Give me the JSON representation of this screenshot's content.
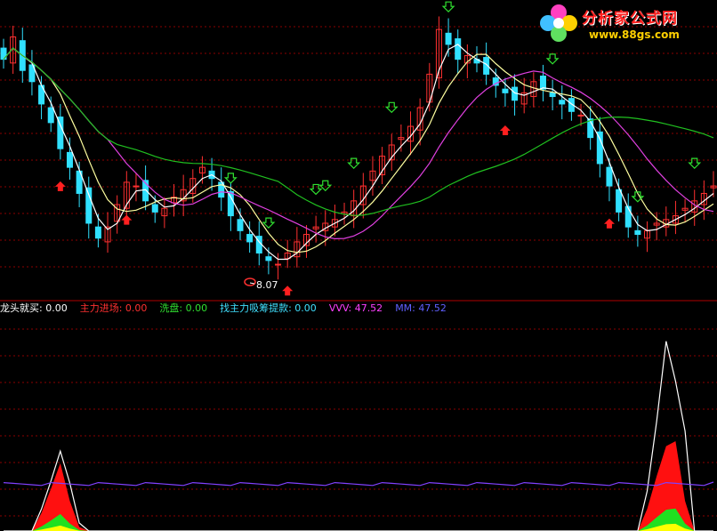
{
  "logo": {
    "brand": "分析家公式网",
    "url": "www.88gs.com"
  },
  "indicator_bar": [
    {
      "label": "龙头就买:",
      "value": "0.00",
      "color": "#ffffff"
    },
    {
      "label": "主力进场:",
      "value": "0.00",
      "color": "#ff3030"
    },
    {
      "label": "洗盘:",
      "value": "0.00",
      "color": "#30e030"
    },
    {
      "label": "找主力吸筹提款:",
      "value": "0.00",
      "color": "#40e0ff"
    },
    {
      "label": "VVV:",
      "value": "47.52",
      "color": "#ff40ff"
    },
    {
      "label": "MM:",
      "value": "47.52",
      "color": "#6060ff"
    }
  ],
  "price_low_marker": "8.07",
  "colors": {
    "up": "#ff3030",
    "down": "#30e0ff",
    "ma_short": "#ffffff",
    "ma_mid": "#ffffa0",
    "ma_long": "#e040e0",
    "ma_xlong": "#20c020",
    "grid": "#8b0000",
    "divider": "#a00000"
  },
  "chart_data": [
    {
      "type": "candlestick",
      "panel": "price",
      "closes": [
        13.8,
        14.4,
        13.5,
        13.2,
        12.6,
        12.1,
        11.4,
        10.9,
        10.2,
        9.4,
        9.0,
        9.3,
        9.9,
        10.5,
        10.4,
        10.0,
        9.7,
        9.8,
        10.1,
        10.3,
        10.6,
        10.9,
        10.6,
        10.1,
        9.6,
        9.2,
        8.9,
        8.6,
        8.4,
        8.3,
        8.6,
        8.9,
        9.1,
        9.3,
        9.4,
        9.5,
        9.7,
        10.0,
        10.4,
        10.8,
        11.2,
        11.5,
        11.7,
        12.0,
        12.5,
        13.4,
        14.6,
        14.2,
        13.8,
        13.9,
        13.7,
        13.4,
        13.1,
        12.9,
        12.7,
        12.9,
        13.2,
        13.0,
        12.8,
        12.6,
        12.4,
        12.3,
        11.7,
        11.0,
        10.4,
        9.7,
        9.3,
        9.1,
        9.2,
        9.4,
        9.5,
        9.6,
        9.8,
        10.0,
        10.2,
        10.4
      ],
      "marks": {
        "green_down_arrows": 10,
        "red_up_arrows": 5
      }
    },
    {
      "type": "area",
      "panel": "indicator",
      "series": [
        {
          "name": "主力进场",
          "values": [
            0,
            0,
            0,
            0,
            18,
            42,
            68,
            30,
            4,
            0,
            0,
            0,
            0,
            0,
            0,
            0,
            0,
            0,
            0,
            0,
            0,
            0,
            0,
            0,
            0,
            0,
            0,
            0,
            0,
            0,
            0,
            0,
            0,
            0,
            0,
            0,
            0,
            0,
            0,
            0,
            0,
            0,
            0,
            0,
            0,
            0,
            0,
            0,
            0,
            0,
            0,
            0,
            0,
            0,
            0,
            0,
            0,
            0,
            0,
            0,
            0,
            0,
            0,
            0,
            0,
            0,
            0,
            0,
            22,
            55,
            85,
            90,
            30,
            0,
            0,
            0
          ]
        },
        {
          "name": "龙头就买",
          "values": [
            0,
            0,
            0,
            0,
            22,
            50,
            80,
            48,
            8,
            0,
            0,
            0,
            0,
            0,
            0,
            0,
            0,
            0,
            0,
            0,
            0,
            0,
            0,
            0,
            0,
            0,
            0,
            0,
            0,
            0,
            0,
            0,
            0,
            0,
            0,
            0,
            0,
            0,
            0,
            0,
            0,
            0,
            0,
            0,
            0,
            0,
            0,
            0,
            0,
            0,
            0,
            0,
            0,
            0,
            0,
            0,
            0,
            0,
            0,
            0,
            0,
            0,
            0,
            0,
            0,
            0,
            0,
            0,
            40,
            110,
            190,
            150,
            100,
            0,
            0,
            0
          ]
        },
        {
          "name": "VVV",
          "values": [
            47,
            47,
            47,
            47,
            47,
            47,
            47,
            47,
            47,
            47,
            47,
            47,
            47,
            47,
            47,
            47,
            47,
            47,
            47,
            47,
            47,
            47,
            47,
            47,
            47,
            47,
            47,
            47,
            47,
            47,
            47,
            47,
            47,
            47,
            47,
            47,
            47,
            47,
            47,
            47,
            47,
            47,
            47,
            47,
            47,
            47,
            47,
            47,
            47,
            47,
            47,
            47,
            47,
            47,
            47,
            47,
            47,
            47,
            47,
            47,
            47,
            47,
            47,
            47,
            47,
            47,
            47,
            47,
            47,
            47,
            47,
            47,
            47,
            47,
            47,
            47.52
          ]
        }
      ]
    }
  ]
}
